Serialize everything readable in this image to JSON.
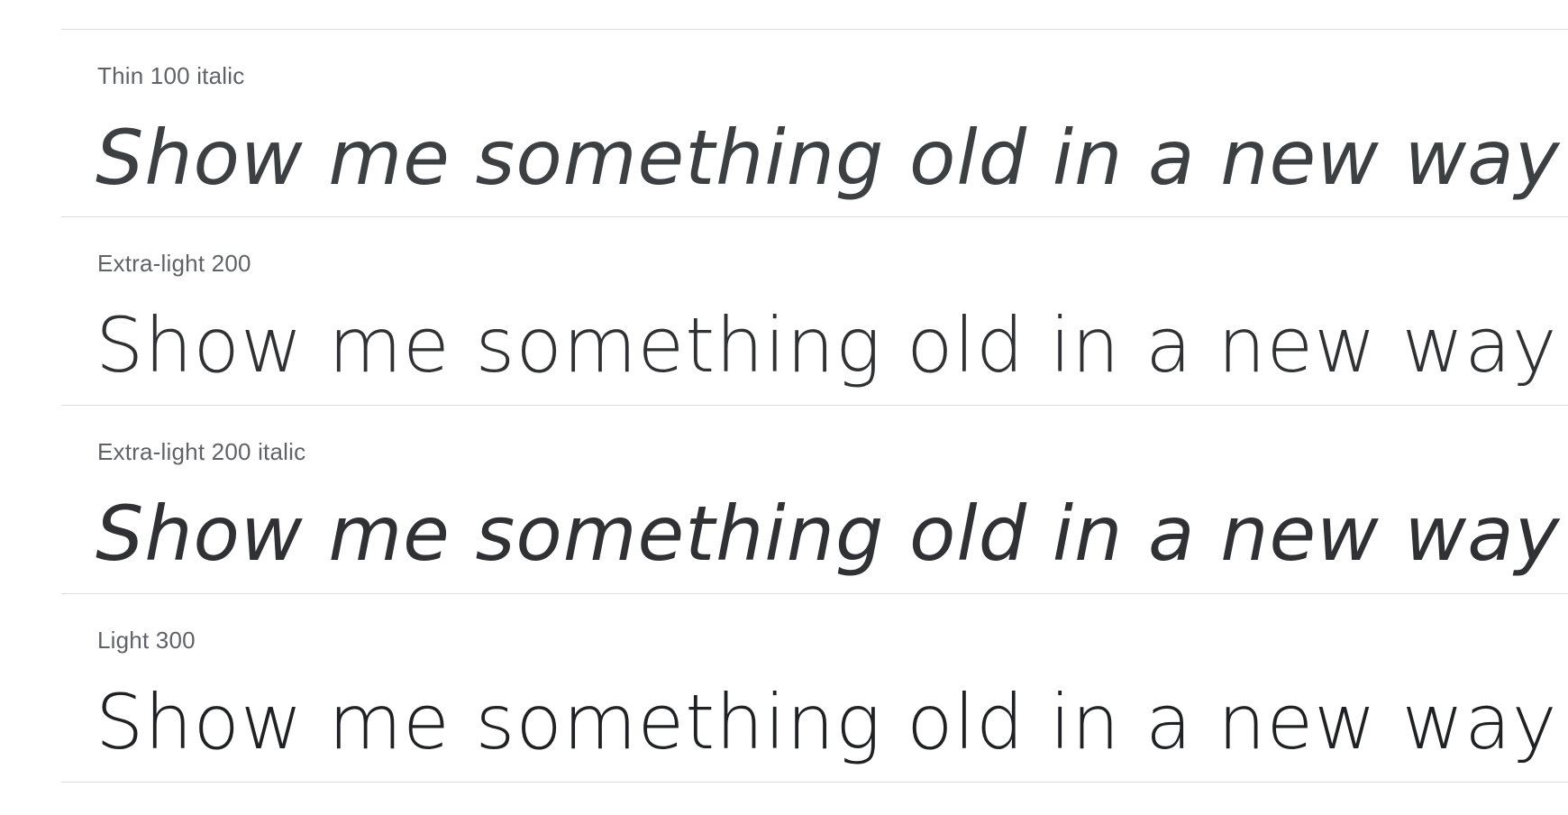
{
  "sample_text": "Show me something old in a new way",
  "rows": [
    {
      "label": "Thin 100 italic",
      "sample": "Show me something old in a new way"
    },
    {
      "label": "Extra-light 200",
      "sample": "Show me something old in a new way"
    },
    {
      "label": "Extra-light 200 italic",
      "sample": "Show me something old in a new way"
    },
    {
      "label": "Light 300",
      "sample": "Show me something old in a new way"
    }
  ],
  "colors": {
    "label": "#5f6368",
    "sample": "#202124",
    "divider": "#dadce0",
    "background": "#ffffff"
  }
}
